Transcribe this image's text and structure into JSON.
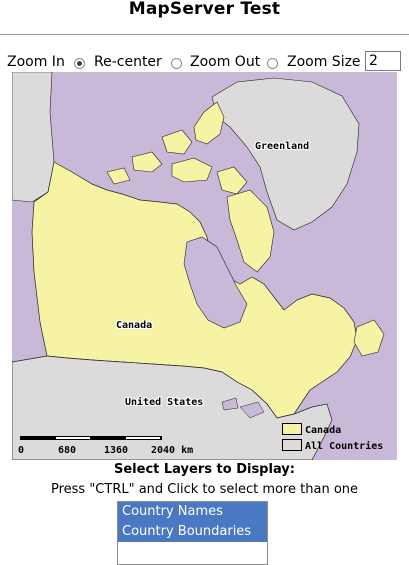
{
  "page": {
    "title": "MapServer Test"
  },
  "controls": {
    "zoom_in_label": "Zoom In",
    "recenter_label": "Re-center",
    "zoom_out_label": "Zoom Out",
    "zoom_size_label": "Zoom Size",
    "zoom_size_value": "2",
    "selected_mode": "recenter"
  },
  "map": {
    "labels": {
      "greenland": "Greenland",
      "canada": "Canada",
      "united_states": "United States"
    },
    "scalebar": {
      "ticks": [
        "0",
        "680",
        "1360",
        "2040 km"
      ]
    },
    "legend": {
      "items": [
        {
          "label": "Canada",
          "color": "#f6f3a4"
        },
        {
          "label": "All Countries",
          "color": "#dcdada"
        }
      ]
    },
    "colors": {
      "water": "#c9b9d9",
      "canada": "#f6f3a4",
      "other_countries": "#dcdada",
      "border": "#222222"
    }
  },
  "layers": {
    "title": "Select Layers to Display:",
    "hint": "Press \"CTRL\" and Click to select more than one",
    "options": [
      "Country Names",
      "Country Boundaries"
    ],
    "selected": [
      "Country Names",
      "Country Boundaries"
    ]
  }
}
